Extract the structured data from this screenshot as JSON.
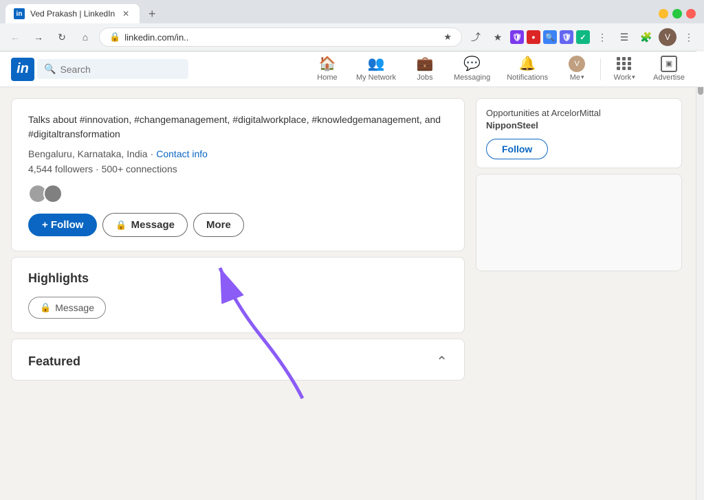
{
  "browser": {
    "tab_title": "Ved Prakash | LinkedIn",
    "url": "linkedin.com/in..",
    "new_tab_label": "+",
    "back_btn": "←",
    "forward_btn": "→",
    "refresh_btn": "↻",
    "home_btn": "⌂"
  },
  "nav": {
    "logo": "in",
    "search_placeholder": "Search",
    "items": [
      {
        "id": "home",
        "label": "Home",
        "icon": "🏠"
      },
      {
        "id": "my-network",
        "label": "My Network",
        "icon": "👥"
      },
      {
        "id": "jobs",
        "label": "Jobs",
        "icon": "💼"
      },
      {
        "id": "messaging",
        "label": "Messaging",
        "icon": "💬"
      },
      {
        "id": "notifications",
        "label": "Notifications",
        "icon": "🔔"
      },
      {
        "id": "me",
        "label": "Me",
        "icon": "avatar"
      },
      {
        "id": "work",
        "label": "Work",
        "icon": "⋮⋮⋮"
      },
      {
        "id": "advertise",
        "label": "Advertise",
        "icon": "◻"
      }
    ]
  },
  "profile": {
    "bio": "Talks about #innovation, #changemanagement, #digitalworkplace, #knowledgemanagement, and #digitaltransformation",
    "location": "Bengaluru, Karnataka, India",
    "contact_info_label": "Contact info",
    "stats": "4,544 followers · 500+ connections",
    "follow_btn": "+ Follow",
    "message_btn": "Message",
    "more_btn": "More"
  },
  "highlights": {
    "title": "Highlights",
    "message_btn": "Message"
  },
  "featured": {
    "title": "Featured"
  },
  "right_panel": {
    "card1": {
      "text_line1": "Opportunities at ArcelorMittal",
      "text_line2": "NipponSteel",
      "follow_btn": "Follow"
    }
  }
}
